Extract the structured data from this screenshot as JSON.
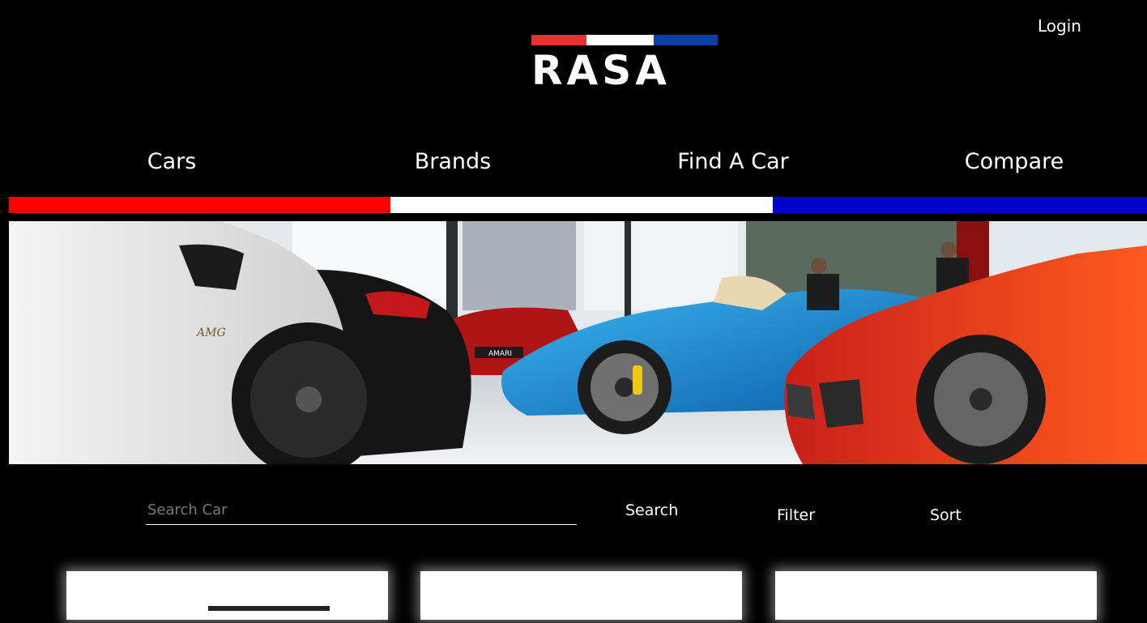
{
  "header": {
    "login_label": "Login",
    "logo_text": "RASA",
    "logo_stripe_colors": [
      "#e8302f",
      "#ffffff",
      "#0c3fa5"
    ]
  },
  "nav": {
    "items": [
      {
        "label": "Cars"
      },
      {
        "label": "Brands"
      },
      {
        "label": "Find A Car"
      },
      {
        "label": "Compare"
      }
    ]
  },
  "flag_bar_colors": [
    "#ff0000",
    "#ffffff",
    "#0000cc"
  ],
  "hero": {
    "image_icon": "showroom-cars-image",
    "badge_text": "AMARI"
  },
  "search": {
    "placeholder": "Search Car",
    "value": "",
    "search_label": "Search",
    "filter_label": "Filter",
    "sort_label": "Sort"
  },
  "cards": [
    {
      "name": "car-card-1"
    },
    {
      "name": "car-card-2"
    },
    {
      "name": "car-card-3"
    }
  ]
}
